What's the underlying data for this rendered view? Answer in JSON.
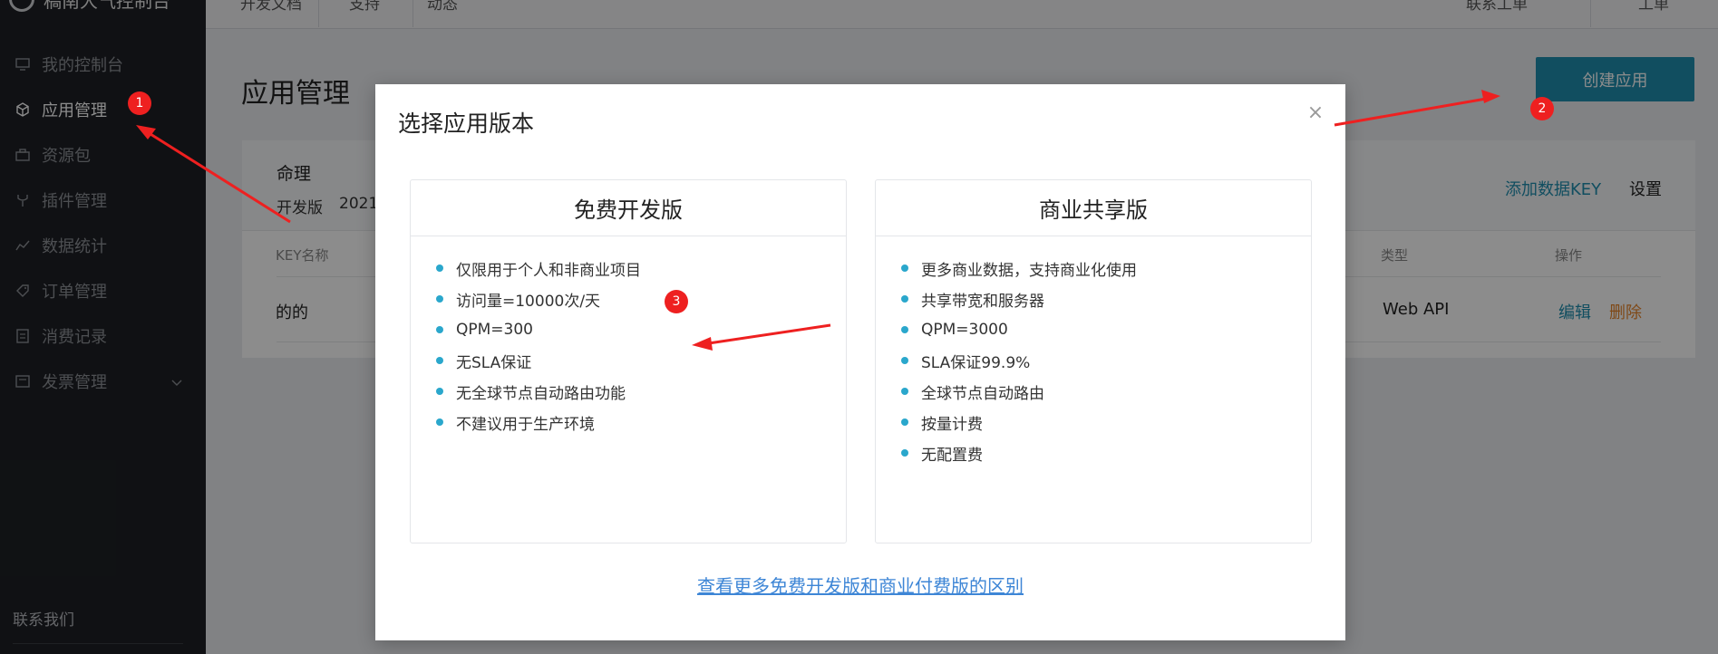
{
  "sidebar": {
    "brand": "稿南大气控制台",
    "items": [
      {
        "label": "我的控制台",
        "icon": "monitor-icon"
      },
      {
        "label": "应用管理",
        "icon": "cube-icon",
        "active": true
      },
      {
        "label": "资源包",
        "icon": "briefcase-icon"
      },
      {
        "label": "插件管理",
        "icon": "plugin-icon"
      },
      {
        "label": "数据统计",
        "icon": "chart-icon"
      },
      {
        "label": "订单管理",
        "icon": "tag-icon"
      },
      {
        "label": "消费记录",
        "icon": "receipt-icon"
      },
      {
        "label": "发票管理",
        "icon": "invoice-icon",
        "expandable": true
      }
    ],
    "contact": "联系我们"
  },
  "topbar": {
    "links": [
      "开发文档",
      "支持",
      "动态"
    ],
    "right_links": [
      "联系工单",
      "工单"
    ]
  },
  "main": {
    "title": "应用管理",
    "create_button": "创建应用",
    "app": {
      "name": "命理",
      "edition": "开发版",
      "date": "2021",
      "add_key": "添加数据KEY",
      "settings": "设置"
    },
    "table": {
      "headers": {
        "key_name": "KEY名称",
        "type": "类型",
        "action": "操作"
      },
      "row": {
        "key_name": "的的",
        "type": "Web API",
        "edit": "编辑",
        "delete": "删除"
      }
    }
  },
  "modal": {
    "title": "选择应用版本",
    "close_label": "×",
    "plans": [
      {
        "name": "免费开发版",
        "features": [
          "仅限用于个人和非商业项目",
          "访问量=10000次/天",
          "QPM=300",
          "无SLA保证",
          "无全球节点自动路由功能",
          "不建议用于生产环境"
        ]
      },
      {
        "name": "商业共享版",
        "features": [
          "更多商业数据，支持商业化使用",
          "共享带宽和服务器",
          "QPM=3000",
          "SLA保证99.9%",
          "全球节点自动路由",
          "按量计费",
          "无配置费"
        ]
      }
    ],
    "compare_link": "查看更多免费开发版和商业付费版的区别"
  },
  "annotations": {
    "badges": [
      "1",
      "2",
      "3"
    ],
    "color": "#ee2020"
  }
}
